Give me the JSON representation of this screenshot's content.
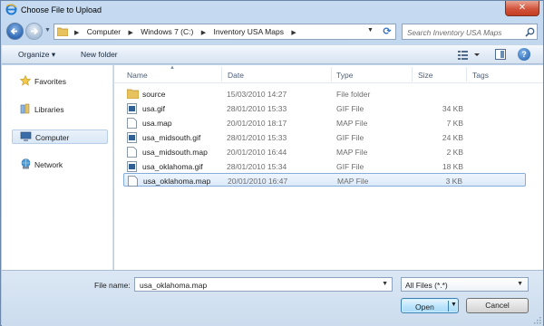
{
  "window": {
    "title": "Choose File to Upload",
    "close_label": "✕"
  },
  "address": {
    "crumbs": [
      "Computer",
      "Windows 7 (C:)",
      "Inventory USA Maps"
    ],
    "search_placeholder": "Search Inventory USA Maps"
  },
  "toolbar": {
    "organize_label": "Organize ▾",
    "new_folder_label": "New folder",
    "help_label": "?"
  },
  "nav": {
    "items": [
      {
        "label": "Favorites",
        "icon": "star-icon"
      },
      {
        "label": "Libraries",
        "icon": "library-icon"
      },
      {
        "label": "Computer",
        "icon": "computer-icon"
      },
      {
        "label": "Network",
        "icon": "network-icon"
      }
    ]
  },
  "columns": {
    "name": "Name",
    "date": "Date",
    "type": "Type",
    "size": "Size",
    "tags": "Tags"
  },
  "files": [
    {
      "name": "source",
      "date": "15/03/2010 14:27",
      "type": "File folder",
      "size": "",
      "icon": "folder-icon"
    },
    {
      "name": "usa.gif",
      "date": "28/01/2010 15:33",
      "type": "GIF File",
      "size": "34 KB",
      "icon": "image-file-icon"
    },
    {
      "name": "usa.map",
      "date": "20/01/2010 18:17",
      "type": "MAP File",
      "size": "7 KB",
      "icon": "file-icon"
    },
    {
      "name": "usa_midsouth.gif",
      "date": "28/01/2010 15:33",
      "type": "GIF File",
      "size": "24 KB",
      "icon": "image-file-icon"
    },
    {
      "name": "usa_midsouth.map",
      "date": "20/01/2010 16:44",
      "type": "MAP File",
      "size": "2 KB",
      "icon": "file-icon"
    },
    {
      "name": "usa_oklahoma.gif",
      "date": "28/01/2010 15:34",
      "type": "GIF File",
      "size": "18 KB",
      "icon": "image-file-icon"
    },
    {
      "name": "usa_oklahoma.map",
      "date": "20/01/2010 16:47",
      "type": "MAP File",
      "size": "3 KB",
      "icon": "file-icon"
    }
  ],
  "selected_file_index": 6,
  "bottom": {
    "file_name_label": "File name:",
    "file_name_value": "usa_oklahoma.map",
    "filter_value": "All Files (*.*)",
    "open_label": "Open",
    "cancel_label": "Cancel"
  },
  "colors": {
    "selection_border": "#84acdd",
    "window_frame": "#b5cce6",
    "accent": "#2b6fc2"
  }
}
